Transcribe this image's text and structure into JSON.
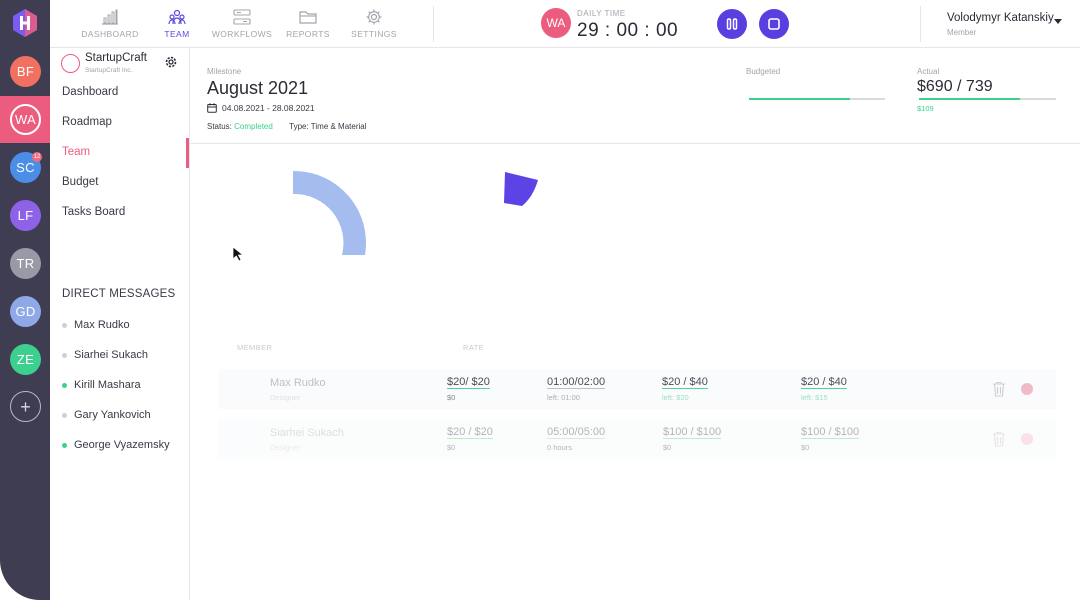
{
  "workspaces": {
    "items": [
      {
        "initials": "BF",
        "color": "#f2705f",
        "badge": ""
      },
      {
        "initials": "WA",
        "color": "#ec5c7e",
        "badge": ""
      },
      {
        "initials": "SC",
        "color": "#4a8ee8",
        "badge": "12"
      },
      {
        "initials": "LF",
        "color": "#8d62e8",
        "badge": ""
      },
      {
        "initials": "TR",
        "color": "#9a99a6",
        "badge": ""
      },
      {
        "initials": "GD",
        "color": "#8fa9e8",
        "badge": ""
      },
      {
        "initials": "ZE",
        "color": "#3ccf8e",
        "badge": ""
      }
    ],
    "add_label": "+"
  },
  "nav": {
    "dashboard": "DASHBOARD",
    "team": "TEAM",
    "workflows": "WORKFLOWS",
    "reports": "REPORTS",
    "settings": "SETTINGS"
  },
  "timer": {
    "avatar": "WA",
    "label": "DAILY TIME",
    "value": "29 : 00 : 00"
  },
  "user": {
    "name": "Volodymyr Katanskiy",
    "role": "Member"
  },
  "project": {
    "name": "StartupCraft",
    "company": "StartupCraft Inc.",
    "links": [
      "Dashboard",
      "Roadmap",
      "Team",
      "Budget",
      "Tasks Board"
    ],
    "active_link": "Team"
  },
  "direct_messages": {
    "heading": "DIRECT MESSAGES",
    "people": [
      {
        "name": "Max Rudko",
        "online": false
      },
      {
        "name": "Siarhei Sukach",
        "online": false
      },
      {
        "name": "Kirill Mashara",
        "online": true
      },
      {
        "name": "Gary Yankovich",
        "online": false
      },
      {
        "name": "George Vyazemsky",
        "online": true
      }
    ]
  },
  "milestone": {
    "label": "Milestone",
    "title": "August 2021",
    "dates": "04.08.2021 - 28.08.2021",
    "status_label": "Status:",
    "status_value": "Completed",
    "type_label": "Type:",
    "type_value": "Time & Material"
  },
  "budget": {
    "budgeted_label": "Budgeted",
    "budgeted_fill": 0.74,
    "actual_label": "Actual",
    "actual_value": "$690 / 739",
    "actual_fill": 0.74,
    "actual_sub": "$109"
  },
  "team_table": {
    "columns": {
      "member": "MEMBER",
      "rate": "RATE"
    },
    "rows": [
      {
        "name": "Max Rudko",
        "role": "Designer",
        "rate": "$20/ $20",
        "rate_sub": "$0",
        "time": "01:00/02:00",
        "time_sub": "left: 01:00",
        "cost1": "$20 / $40",
        "cost1_sub": "left: $20",
        "cost2": "$20 / $40",
        "cost2_sub": "left: $15"
      },
      {
        "name": "Siarhei Sukach",
        "role": "Designer",
        "rate": "$20 / $20",
        "rate_sub": "$0",
        "time": "05:00/05:00",
        "time_sub": "0 hours",
        "cost1": "$100 / $100",
        "cost1_sub": "$0",
        "cost2": "$100 / $100",
        "cost2_sub": "$0"
      }
    ]
  },
  "colors": {
    "accent_pink": "#ec5c7e",
    "accent_purple": "#5a3fe0",
    "success_green": "#3ccf8e",
    "chart_light_blue": "#a4bdee",
    "chart_indigo": "#5b43e6"
  }
}
